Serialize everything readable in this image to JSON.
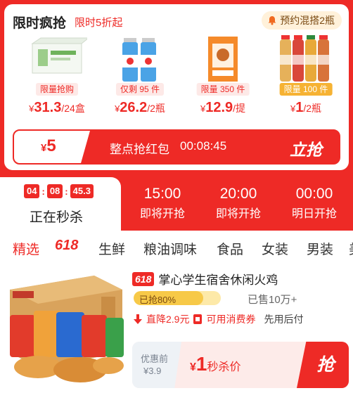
{
  "flash": {
    "title": "限时疯抢",
    "subtitle": "限时5折起",
    "reserve_label": "预约混搭2瓶",
    "products": [
      {
        "tag": "限量抢购",
        "currency": "¥",
        "price": "31.3",
        "unit": "/24盒",
        "tag_style": "red"
      },
      {
        "tag": "仅剩 95 件",
        "currency": "¥",
        "price": "26.2",
        "unit": "/2瓶",
        "tag_style": "red"
      },
      {
        "tag": "限量 350 件",
        "currency": "¥",
        "price": "12.9",
        "unit": "/提",
        "tag_style": "red"
      },
      {
        "tag": "限量 100 件",
        "currency": "¥",
        "price": "1",
        "unit": "/2瓶",
        "tag_style": "gold"
      }
    ],
    "redpack": {
      "currency": "¥",
      "amount": "5",
      "label": "整点抢红包",
      "timer": "00:08:45",
      "grab_label": "立抢"
    }
  },
  "sessions": {
    "countdown": [
      "04",
      "08",
      "45.3"
    ],
    "current_label": "正在秒杀",
    "items": [
      {
        "time": "15:00",
        "status": "即将开抢"
      },
      {
        "time": "20:00",
        "status": "即将开抢"
      },
      {
        "time": "00:00",
        "status": "明日开抢"
      }
    ]
  },
  "categories": {
    "active": "精选",
    "special": "618",
    "items": [
      "生鲜",
      "粮油调味",
      "食品",
      "女装",
      "男装",
      "美"
    ]
  },
  "item": {
    "badge": "618",
    "title": "掌心学生宿舍休闲火鸡",
    "progress_label": "已抢80%",
    "progress_value": 0.8,
    "sold": "已售10万+",
    "price_drop": "直降2.9元",
    "voucher": "可用消费券",
    "later_pay": "先用后付",
    "orig_label": "优惠前",
    "orig_price": "¥3.9",
    "sale_currency": "¥",
    "sale_price": "1",
    "sale_label": "秒杀价",
    "buy_label": "抢"
  },
  "colors": {
    "accent": "#ee2a26",
    "gold": "#f6b233",
    "progress": "#f7c948"
  }
}
